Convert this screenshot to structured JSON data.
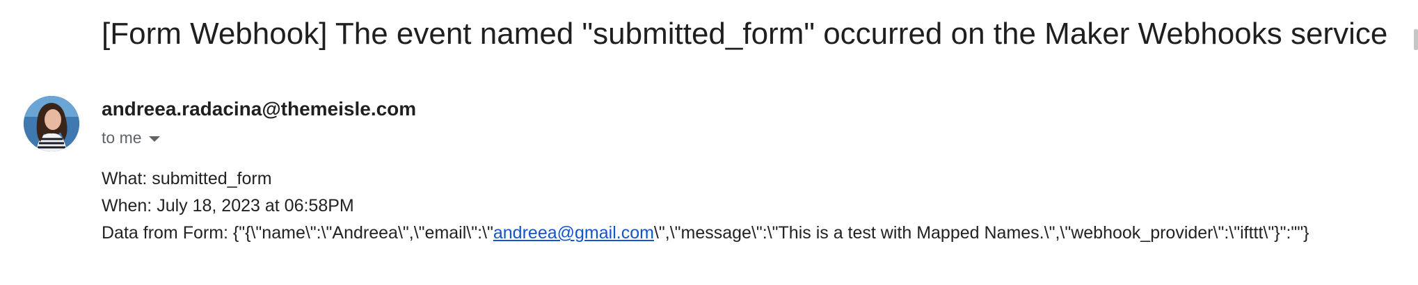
{
  "email": {
    "subject": "[Form Webhook] The event named \"submitted_form\" occurred on the Maker Webhooks service",
    "sender": "andreea.radacina@themeisle.com",
    "recipient_label": "to me",
    "body": {
      "what": "What: submitted_form",
      "when": "When: July 18, 2023 at 06:58PM",
      "data_prefix": "Data from Form: {\"{\\\"name\\\":\\\"Andreea\\\",\\\"email\\\":\\\"",
      "data_link": "andreea@gmail.com",
      "data_suffix": "\\\",\\\"message\\\":\\\"This is a test with Mapped Names.\\\",\\\"webhook_provider\\\":\\\"ifttt\\\"}\":\"\"}"
    }
  },
  "colors": {
    "link": "#1155cc",
    "muted": "#5f6368"
  },
  "icons": {
    "avatar": "profile-photo",
    "recipient_caret": "caret-down-icon"
  }
}
